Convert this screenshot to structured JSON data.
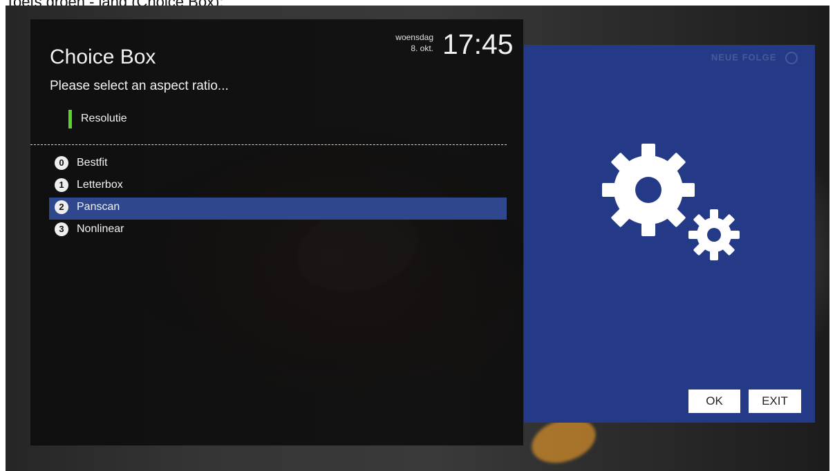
{
  "caption": {
    "text": "Toets groen - lang (Choice Box):"
  },
  "header": {
    "title": "Choice Box",
    "prompt": "Please select an aspect ratio...",
    "day": "woensdag",
    "date": "8. okt.",
    "time": "17:45"
  },
  "section": {
    "label": "Resolutie",
    "accent_color": "#5ad32a"
  },
  "choices": [
    {
      "number": "0",
      "label": "Bestfit",
      "selected": false
    },
    {
      "number": "1",
      "label": "Letterbox",
      "selected": false
    },
    {
      "number": "2",
      "label": "Panscan",
      "selected": true
    },
    {
      "number": "3",
      "label": "Nonlinear",
      "selected": false
    }
  ],
  "side_panel": {
    "watermark": "NEUE FOLGE",
    "icon": "gears-icon",
    "background_color": "#243a87"
  },
  "buttons": {
    "ok": "OK",
    "exit": "EXIT"
  }
}
